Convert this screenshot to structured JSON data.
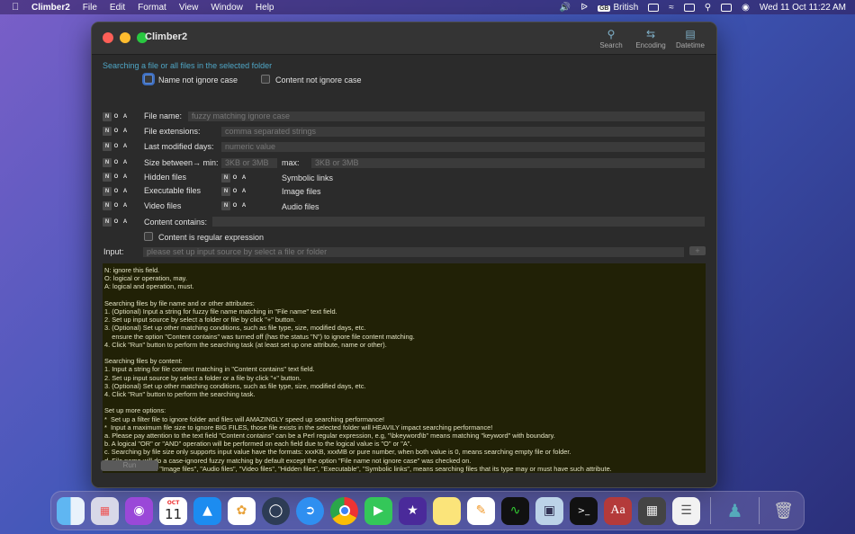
{
  "menubar": {
    "app_name": "Climber2",
    "items": [
      "File",
      "Edit",
      "Format",
      "View",
      "Window",
      "Help"
    ],
    "keyboard_layout": "British",
    "keyboard_badge": "GB",
    "datetime": "Wed 11 Oct  11:22 AM"
  },
  "window": {
    "title": "Climber2",
    "toolbar": [
      {
        "label": "Search",
        "icon": "search-icon"
      },
      {
        "label": "Encoding",
        "icon": "encoding-icon"
      },
      {
        "label": "Datetime",
        "icon": "calendar-icon"
      }
    ]
  },
  "form": {
    "hint": "Searching a file or all files in the selected folder",
    "name_not_ignore_case": "Name not ignore case",
    "content_not_ignore_case": "Content not ignore case",
    "noa": [
      "N",
      "O",
      "A"
    ],
    "file_name_label": "File name:",
    "file_name_placeholder": "fuzzy matching ignore case",
    "file_ext_label": "File extensions:",
    "file_ext_placeholder": "comma separated strings",
    "last_modified_label": "Last modified days:",
    "last_modified_placeholder": "numeric value",
    "size_label": "Size between→  min:",
    "size_min_placeholder": "3KB or 3MB",
    "size_max_label": "max:",
    "size_max_placeholder": "3KB or 3MB",
    "hidden_files": "Hidden files",
    "symbolic_links": "Symbolic links",
    "executable_files": "Executable files",
    "image_files": "Image files",
    "video_files": "Video files",
    "audio_files": "Audio files",
    "content_contains_label": "Content contains:",
    "content_regex": "Content is regular expression",
    "input_label": "Input:",
    "input_placeholder": "please set up input source by select a file or folder",
    "plus_button": "+",
    "run_button": "Run"
  },
  "help_lines": [
    "N: ignore this field.",
    "O: logical or operation, may.",
    "A: logical and operation, must.",
    "",
    "Searching files by file name and or other attributes:",
    "1. (Optional) Input a string for fuzzy file name matching in \"File name\" text field.",
    "2. Set up input source by select a folder or file by click \"+\" button.",
    "3. (Optional) Set up other matching conditions, such as file type, size, modified days, etc.",
    "    ensure the option \"Content contains\" was turned off (has the status \"N\") to ignore file content matching.",
    "4. Click \"Run\" button to perform the searching task (at least set up one attribute, name or other).",
    "",
    "Searching files by content:",
    "1. Input a string for file content matching in \"Content contains\" text field.",
    "2. Set up input source by select a folder or a file by click \"+\" button.",
    "3. (Optional) Set up other matching conditions, such as file type, size, modified days, etc.",
    "4. Click \"Run\" button to perform the searching task.",
    "",
    "Set up more options:",
    "*  Set up a filter file to ignore folder and files will AMAZINGLY speed up searching performance!",
    "*  Input a maximum file size to ignore BIG FILES, those file exists in the selected folder will HEAVILY impact searching performance!",
    "a. Please pay attention to the text field \"Content contains\" can be a Perl regular expression, e.g, \"\\bkeyword\\b\" means matching \"keyword\" with boundary.",
    "b. A logical \"OR\" or \"AND\" operation will be performed on each field due to the logical value is \"O\" or \"A\".",
    "c. Searching by file size only supports input value have the formats: xxxKB, xxxMB or pure number, when both value is 0, means searching empty file or folder.",
    "d. File name will do a case-ignored fuzzy matching by default except the option \"File name not ignore case\" was checked on.",
    "e. When check on \"Image files\", \"Audio files\", \"Video files\", \"Hidden files\", \"Executable\", \"Symbolic links\", means searching files that its type may or must have such attribute."
  ],
  "dock": {
    "calendar_month": "OCT",
    "calendar_day": "11",
    "apps": [
      "finder-icon",
      "launchpad-icon",
      "podcasts-icon",
      "calendar-icon",
      "app-store-icon",
      "photos-icon",
      "quicktime-icon",
      "safari-icon",
      "chrome-icon",
      "facetime-icon",
      "imovie-icon",
      "notes-icon",
      "pages-icon",
      "activity-monitor-icon",
      "preview-icon",
      "terminal-icon",
      "dictionary-icon",
      "calculator-icon",
      "textedit-icon",
      "archive-icon",
      "trash-icon"
    ],
    "dictionary_glyph": "Aa",
    "terminal_glyph": ">_"
  }
}
